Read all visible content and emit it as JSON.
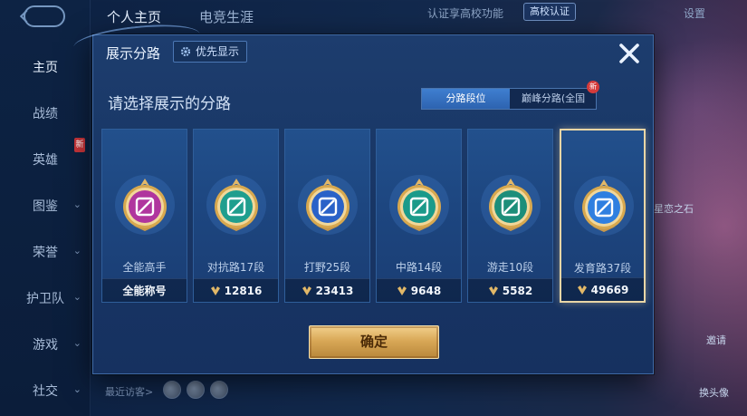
{
  "sidebar": {
    "items": [
      {
        "label": "主页",
        "active": true
      },
      {
        "label": "战绩"
      },
      {
        "label": "英雄"
      },
      {
        "label": "图鉴"
      },
      {
        "label": "荣誉"
      },
      {
        "label": "护卫队"
      },
      {
        "label": "游戏"
      },
      {
        "label": "社交"
      }
    ]
  },
  "topbar": {
    "tabs": [
      "个人主页",
      "电竞生涯"
    ],
    "auth_text": "认证享高校功能",
    "campus_btn": "高校认证",
    "settings": "设置"
  },
  "background": {
    "art_label": "星恋之石",
    "btn1": "邀请",
    "btn2": "换头像",
    "visitor_label": "最近访客>"
  },
  "modal": {
    "title": "展示分路",
    "priority_btn": "优先显示",
    "subtitle": "请选择展示的分路",
    "segment": {
      "opt1": "分路段位",
      "opt2": "巅峰分路(全国",
      "new": "新"
    },
    "confirm": "确定",
    "cards": [
      {
        "name": "全能高手",
        "value": "全能称号",
        "color": "#b0359e",
        "selected": false
      },
      {
        "name": "对抗路17段",
        "value": "12816",
        "color": "#1f9e8e",
        "selected": false
      },
      {
        "name": "打野25段",
        "value": "23413",
        "color": "#2a62c8",
        "selected": false
      },
      {
        "name": "中路14段",
        "value": "9648",
        "color": "#1a9a8a",
        "selected": false
      },
      {
        "name": "游走10段",
        "value": "5582",
        "color": "#1c8e7a",
        "selected": false
      },
      {
        "name": "发育路37段",
        "value": "49669",
        "color": "#2f7fe0",
        "selected": true
      }
    ]
  },
  "colors": {
    "gold": "#e2b868",
    "accent": "#3f7fd0"
  }
}
